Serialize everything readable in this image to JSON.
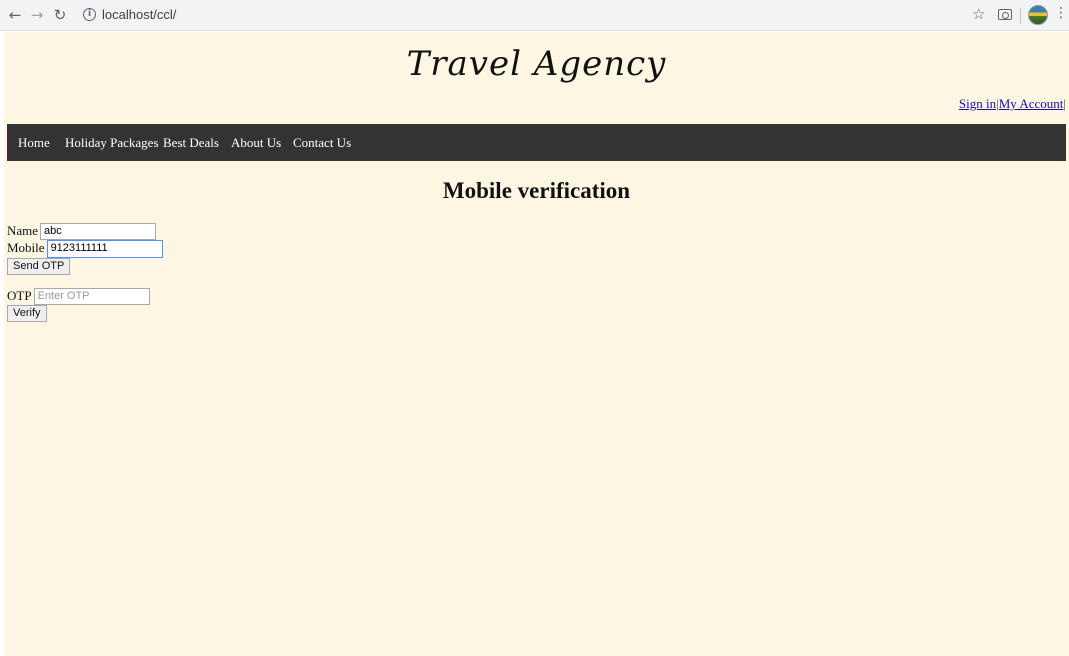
{
  "browser": {
    "url": "localhost/ccl/",
    "icons": {
      "back": "back-arrow-icon",
      "forward": "forward-arrow-icon",
      "reload": "reload-icon",
      "info": "info-icon",
      "star": "star-icon",
      "camera": "camera-icon",
      "avatar": "avatar-icon",
      "menu": "kebab-menu-icon"
    }
  },
  "header": {
    "logo_text": "Travel Agency",
    "sign_in": "Sign in",
    "separator": "|",
    "my_account": "My Account",
    "trailing_separator": "|"
  },
  "nav": {
    "items": [
      {
        "label": "Home"
      },
      {
        "label": "Holiday Packages"
      },
      {
        "label": "Best Deals"
      },
      {
        "label": "About Us"
      },
      {
        "label": "Contact Us"
      }
    ]
  },
  "main": {
    "title": "Mobile verification",
    "name_label": "Name",
    "name_value": "abc",
    "mobile_label": "Mobile",
    "mobile_value": "9123111111",
    "send_otp_label": "Send OTP",
    "otp_label": "OTP",
    "otp_placeholder": "Enter OTP",
    "verify_label": "Verify"
  },
  "colors": {
    "page_background": "#fdf6e3",
    "navbar_background": "#333333",
    "link": "#1a0dab",
    "focus_border": "#4d90fe"
  }
}
